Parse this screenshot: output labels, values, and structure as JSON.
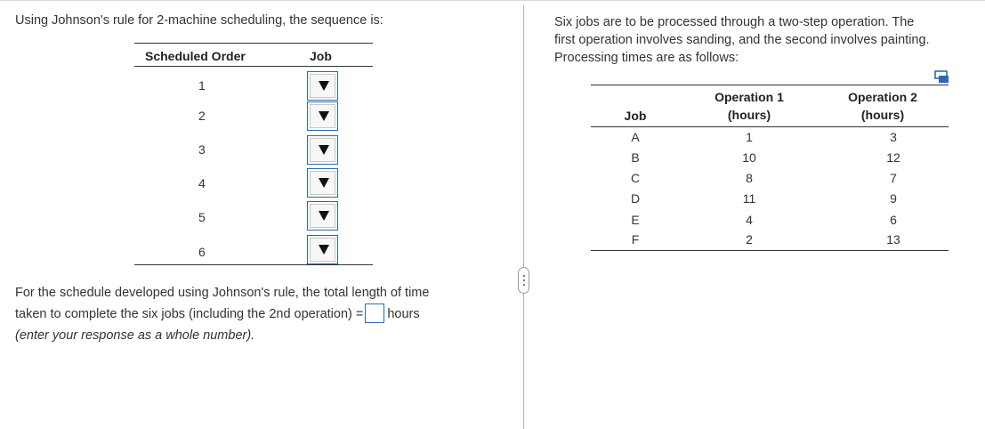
{
  "left": {
    "prompt": "Using Johnson's rule for 2-machine scheduling, the sequence is:",
    "sequence_table": {
      "headers": {
        "order": "Scheduled Order",
        "job": "Job"
      },
      "rows": [
        {
          "order": "1",
          "job": ""
        },
        {
          "order": "2",
          "job": ""
        },
        {
          "order": "3",
          "job": ""
        },
        {
          "order": "4",
          "job": ""
        },
        {
          "order": "5",
          "job": ""
        },
        {
          "order": "6",
          "job": ""
        }
      ]
    },
    "answer": {
      "line1": "For the schedule developed using Johnson's rule, the total length of time",
      "line2_before": "taken to complete the six jobs (including the 2nd operation) =",
      "line2_after": "hours",
      "note": "(enter your response as a whole number).",
      "value": ""
    }
  },
  "right": {
    "line1": "Six jobs are to be processed through a two-step operation.  The",
    "line2": "first operation involves sanding, and the second involves painting.",
    "line3": "Processing times are as follows:",
    "copy_icon": "copy-icon",
    "table": {
      "headers": {
        "job": "Job",
        "op1_line1": "Operation 1",
        "op1_line2": "(hours)",
        "op2_line1": "Operation 2",
        "op2_line2": "(hours)"
      },
      "rows": [
        {
          "job": "A",
          "op1": "1",
          "op2": "3"
        },
        {
          "job": "B",
          "op1": "10",
          "op2": "12"
        },
        {
          "job": "C",
          "op1": "8",
          "op2": "7"
        },
        {
          "job": "D",
          "op1": "11",
          "op2": "9"
        },
        {
          "job": "E",
          "op1": "4",
          "op2": "6"
        },
        {
          "job": "F",
          "op1": "2",
          "op2": "13"
        }
      ]
    }
  }
}
